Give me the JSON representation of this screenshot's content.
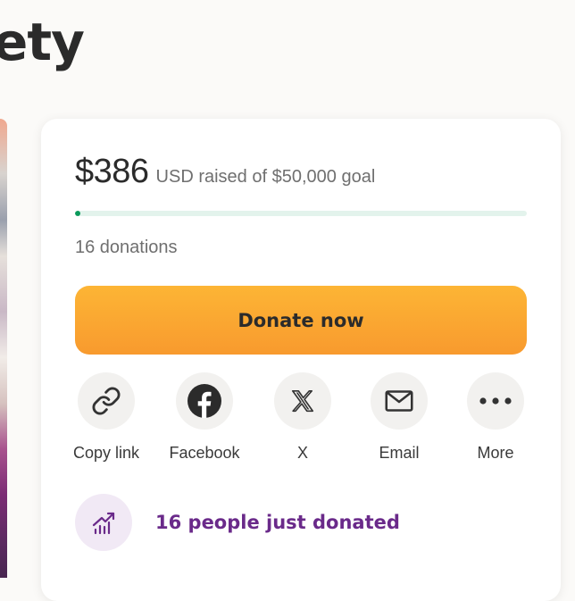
{
  "page": {
    "title_fragment": "ety"
  },
  "fundraiser": {
    "raised_amount": "$386",
    "raised_text": "USD raised of $50,000 goal",
    "progress_fraction": 0.00772,
    "donation_count": "16 donations",
    "donate_button_label": "Donate now"
  },
  "share": {
    "items": [
      {
        "label": "Copy link",
        "icon": "link-icon"
      },
      {
        "label": "Facebook",
        "icon": "facebook-icon"
      },
      {
        "label": "X",
        "icon": "x-logo-icon"
      },
      {
        "label": "Email",
        "icon": "envelope-icon"
      },
      {
        "label": "More",
        "icon": "more-dots-icon"
      }
    ]
  },
  "activity": {
    "recent_donations_text": "16 people just donated",
    "icon": "trending-up-icon"
  },
  "colors": {
    "progress": "#0b9a5b",
    "progress_track": "#e3f3ec",
    "donate_button": "#fdb535",
    "activity_text": "#6a2a8a",
    "activity_icon_bg": "#f1e9f5"
  }
}
